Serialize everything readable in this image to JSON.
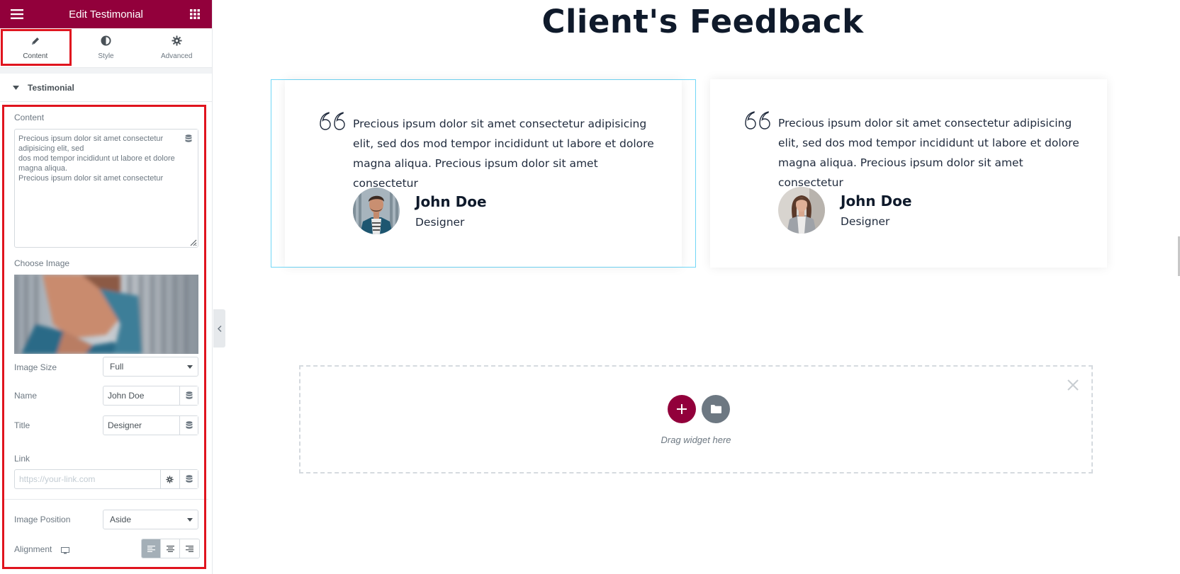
{
  "sidebar": {
    "header": {
      "title": "Edit Testimonial",
      "menu_icon": "hamburger-icon",
      "apps_icon": "grid-icon",
      "bg_color": "#92003b"
    },
    "tabs": [
      {
        "label": "Content",
        "icon": "pencil-icon",
        "active": true
      },
      {
        "label": "Style",
        "icon": "half-circle-icon",
        "active": false
      },
      {
        "label": "Advanced",
        "icon": "gear-icon",
        "active": false
      }
    ],
    "section_title": "Testimonial",
    "controls": {
      "content_label": "Content",
      "content_value": "Precious ipsum dolor sit amet consectetur adipisicing elit, sed\ndos mod tempor incididunt ut labore et dolore magna aliqua.\nPrecious ipsum dolor sit amet consectetur",
      "choose_image_label": "Choose Image",
      "image_size_label": "Image Size",
      "image_size_value": "Full",
      "name_label": "Name",
      "name_value": "John Doe",
      "title_label": "Title",
      "title_value": "Designer",
      "link_label": "Link",
      "link_placeholder": "https://your-link.com",
      "image_position_label": "Image Position",
      "image_position_value": "Aside",
      "alignment_label": "Alignment",
      "alignment_options": [
        "left",
        "center",
        "right"
      ],
      "alignment_selected": "left"
    },
    "highlight_color": "#e0141e"
  },
  "canvas": {
    "page_title": "Client's Feedback",
    "testimonials": [
      {
        "text": "Precious ipsum dolor sit amet consectetur adipisicing elit, sed dos mod tempor incididunt ut labore et dolore magna aliqua. Precious ipsum dolor sit amet consectetur",
        "name": "John Doe",
        "title": "Designer"
      },
      {
        "text": "Precious ipsum dolor sit amet consectetur adipisicing elit, sed dos mod tempor incididunt ut labore et dolore magna aliqua. Precious ipsum dolor sit amet consectetur",
        "name": "John Doe",
        "title": "Designer"
      }
    ],
    "drop_zone": {
      "text": "Drag widget here",
      "add_icon": "plus-icon",
      "template_icon": "folder-icon",
      "close_icon": "close-icon",
      "add_color": "#92003b",
      "template_color": "#6d7882"
    }
  }
}
